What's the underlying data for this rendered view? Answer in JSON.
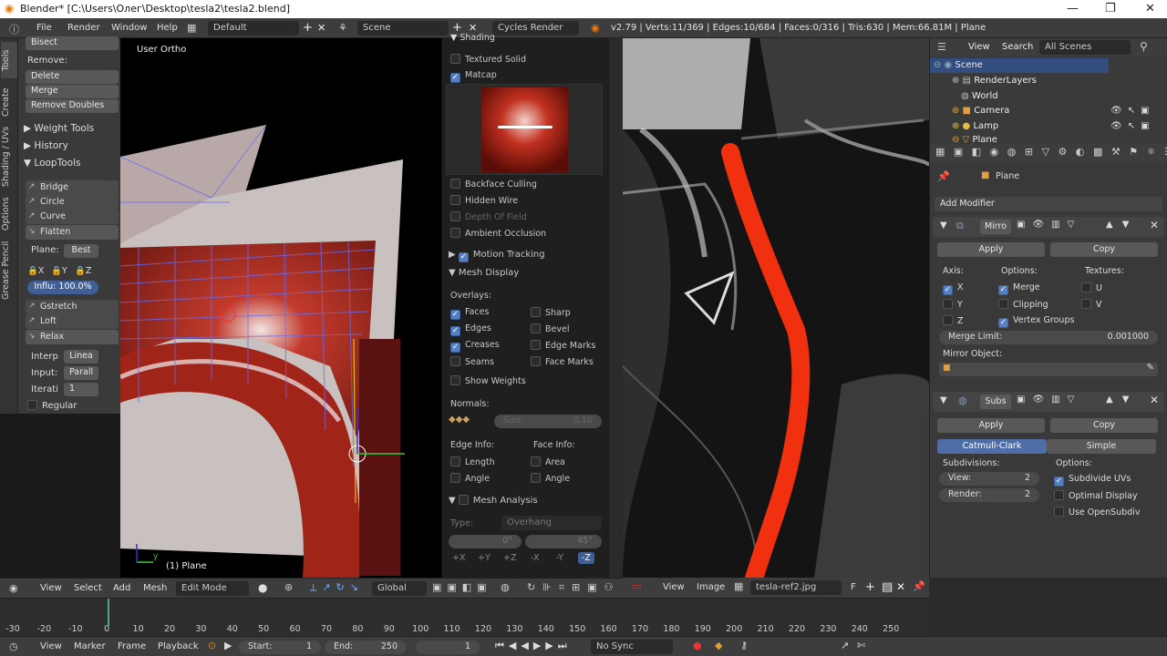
{
  "window": {
    "title": "Blender* [C:\\Users\\Олег\\Desktop\\tesla2\\tesla2.blend]",
    "minimize": "—",
    "maximize": "❐",
    "close": "✕"
  },
  "menus": [
    "File",
    "Render",
    "Window",
    "Help"
  ],
  "layout": "Default",
  "scene": "Scene",
  "engine": "Cycles Render",
  "stats": "v2.79 | Verts:11/369 | Edges:10/684 | Faces:0/316 | Tris:630 | Mem:66.81M | Plane",
  "tabs": [
    "Tools",
    "Create",
    "Shading / UVs",
    "Options",
    "Grease Pencil"
  ],
  "shelf": {
    "bisect": "Bisect",
    "remove_header": "Remove:",
    "delete": "Delete",
    "merge": "Merge",
    "remove_doubles": "Remove Doubles",
    "weight_tools": "Weight Tools",
    "history": "History",
    "looptools": "LoopTools",
    "loop_items": [
      "Bridge",
      "Circle",
      "Curve",
      "Flatten"
    ],
    "plane_label": "Plane:",
    "plane_value": "Best",
    "axes": [
      "X",
      "Y",
      "Z"
    ],
    "influence": "Influ: 100.0%",
    "loop_items2": [
      "Gstretch",
      "Loft",
      "Relax"
    ],
    "interp_label": "Interp",
    "interp_value": "Linea",
    "input_label": "Input:",
    "input_value": "Parall",
    "iter_label": "Iterati",
    "iter_value": "1",
    "regular": "Regular"
  },
  "viewport": {
    "label": "User Ortho",
    "object": "(1) Plane",
    "axis_y": "y"
  },
  "npanel": {
    "shading": "Shading",
    "textured_solid": "Textured Solid",
    "matcap": "Matcap",
    "backface": "Backface Culling",
    "hidden_wire": "Hidden Wire",
    "depth": "Depth Of Field",
    "ao": "Ambient Occlusion",
    "motion": "Motion Tracking",
    "mesh_display": "Mesh Display",
    "overlays": "Overlays:",
    "overlay_left": [
      "Faces",
      "Edges",
      "Creases",
      "Seams"
    ],
    "overlay_right": [
      "Sharp",
      "Bevel",
      "Edge Marks",
      "Face Marks"
    ],
    "show_weights": "Show Weights",
    "normals": "Normals:",
    "size": "Size:",
    "size_value": "0.10",
    "edge_info": "Edge Info:",
    "face_info": "Face Info:",
    "length": "Length",
    "angle": "Angle",
    "area": "Area",
    "angle2": "Angle",
    "mesh_analysis": "Mesh Analysis",
    "type_label": "Type:",
    "type_value": "Overhang",
    "deg0": "0°",
    "deg45": "45°",
    "axes": [
      "+X",
      "+Y",
      "+Z",
      "-X",
      "-Y",
      "-Z"
    ]
  },
  "outliner": {
    "view": "View",
    "search": "Search",
    "filter": "All Scenes",
    "items": [
      "Scene",
      "RenderLayers",
      "World",
      "Camera",
      "Lamp",
      "Plane"
    ]
  },
  "props": {
    "object": "Plane",
    "add_modifier": "Add Modifier",
    "mirror": {
      "name": "Mirro",
      "apply": "Apply",
      "copy": "Copy",
      "axis": "Axis:",
      "options": "Options:",
      "textures": "Textures:",
      "x": "X",
      "y": "Y",
      "z": "Z",
      "merge": "Merge",
      "clipping": "Clipping",
      "vertex_groups": "Vertex Groups",
      "u": "U",
      "v": "V",
      "merge_limit": "Merge Limit:",
      "merge_value": "0.001000",
      "mirror_object": "Mirror Object:"
    },
    "subs": {
      "name": "Subs",
      "apply": "Apply",
      "copy": "Copy",
      "catmull": "Catmull-Clark",
      "simple": "Simple",
      "subdivisions": "Subdivisions:",
      "options": "Options:",
      "view": "View:",
      "view_value": "2",
      "render": "Render:",
      "render_value": "2",
      "subdivide_uvs": "Subdivide UVs",
      "optimal": "Optimal Display",
      "opensubdiv": "Use OpenSubdiv"
    }
  },
  "vphdr": {
    "view": "View",
    "select": "Select",
    "add": "Add",
    "mesh": "Mesh",
    "mode": "Edit Mode",
    "orientation": "Global"
  },
  "imghdr": {
    "view": "View",
    "image": "Image",
    "filename": "tesla-ref2.jpg",
    "f": "F"
  },
  "timeline": {
    "ticks": [
      "-30",
      "-20",
      "-10",
      "0",
      "10",
      "20",
      "30",
      "40",
      "50",
      "60",
      "70",
      "80",
      "90",
      "100",
      "110",
      "120",
      "130",
      "140",
      "150",
      "160",
      "170",
      "180",
      "190",
      "200",
      "210",
      "220",
      "230",
      "240",
      "250"
    ],
    "current": "0"
  },
  "tlhdr": {
    "view": "View",
    "marker": "Marker",
    "frame": "Frame",
    "playback": "Playback",
    "start": "Start:",
    "start_value": "1",
    "end": "End:",
    "end_value": "250",
    "current": "1",
    "sync": "No Sync"
  }
}
